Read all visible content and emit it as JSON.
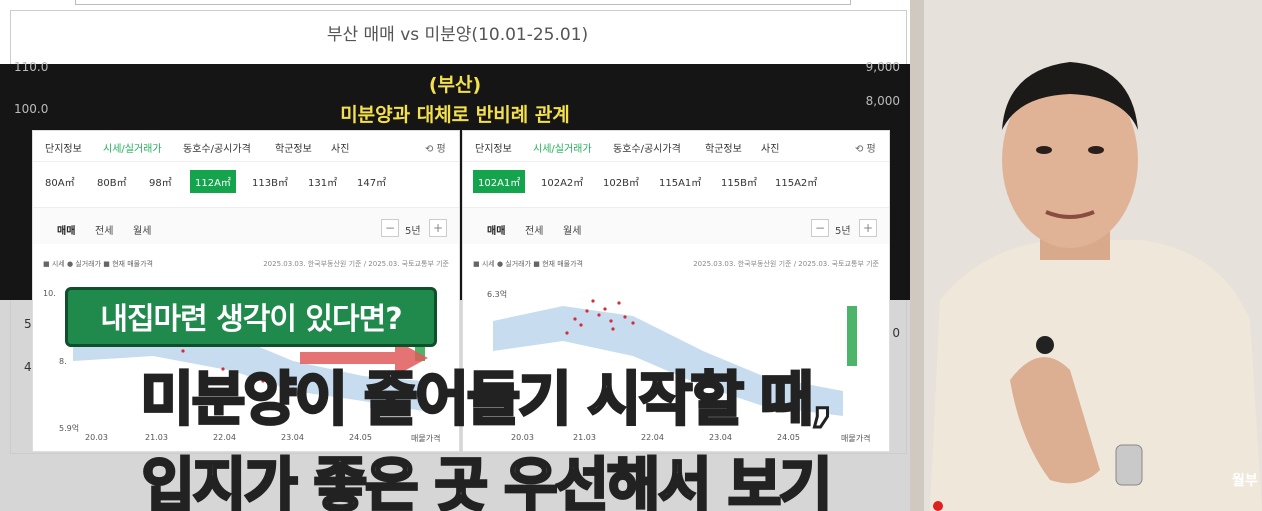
{
  "slide": {
    "chart_title": "부산 매매 vs 미분양(10.01-25.01)",
    "left_axis": [
      "110.0",
      "100.0",
      "5",
      "4"
    ],
    "right_axis": [
      "9,000",
      "8,000",
      "0"
    ],
    "caption_line1": "(부산)",
    "caption_line2": "미분양과 대체로 반비례 관계"
  },
  "panel_left": {
    "tabs": [
      "단지정보",
      "시세/실거래가",
      "동호수/공시가격",
      "학군정보",
      "사진"
    ],
    "active_tab": 1,
    "tab_extra": "⟲ 평",
    "types": [
      "80A㎡",
      "80B㎡",
      "98㎡",
      "112A㎡",
      "113B㎡",
      "131㎡",
      "147㎡"
    ],
    "selected_type": 3,
    "sub_tabs": [
      "매매",
      "전세",
      "월세"
    ],
    "period": "5년",
    "legend": "■ 시세  ● 실거래가  ■ 현재 매물가격",
    "source": "2025.03.03. 한국부동산원 기준 / 2025.03. 국토교통부 기준",
    "y_labels": [
      "10.",
      "8.",
      "5.9억"
    ],
    "x_labels": [
      "20.03",
      "21.03",
      "22.04",
      "23.04",
      "24.05",
      "매물가격"
    ]
  },
  "panel_right": {
    "tabs": [
      "단지정보",
      "시세/실거래가",
      "동호수/공시가격",
      "학군정보",
      "사진"
    ],
    "active_tab": 1,
    "tab_extra": "⟲ 평",
    "types": [
      "102A1㎡",
      "102A2㎡",
      "102B㎡",
      "115A1㎡",
      "115B㎡",
      "115A2㎡"
    ],
    "selected_type": 0,
    "sub_tabs": [
      "매매",
      "전세",
      "월세"
    ],
    "period": "5년",
    "legend": "■ 시세  ● 실거래가  ■ 현재 매물가격",
    "source": "2025.03.03. 한국부동산원 기준 / 2025.03. 국토교통부 기준",
    "y_labels": [
      "6.3억"
    ],
    "x_labels": [
      "20.03",
      "21.03",
      "22.04",
      "23.04",
      "24.05",
      "매물가격"
    ]
  },
  "overlay": {
    "green_caption": "내집마련 생각이 있다면?",
    "line1": "미분양이 줄어들기 시작할 때,",
    "line2": "입지가 좋은 곳 우선해서 보기"
  },
  "watermark": "월부",
  "colors": {
    "accent_green": "#14a44d",
    "caption_yellow": "#f4e04d",
    "transaction_dot": "#d62b3a",
    "band_blue": "#b9d3ea"
  }
}
